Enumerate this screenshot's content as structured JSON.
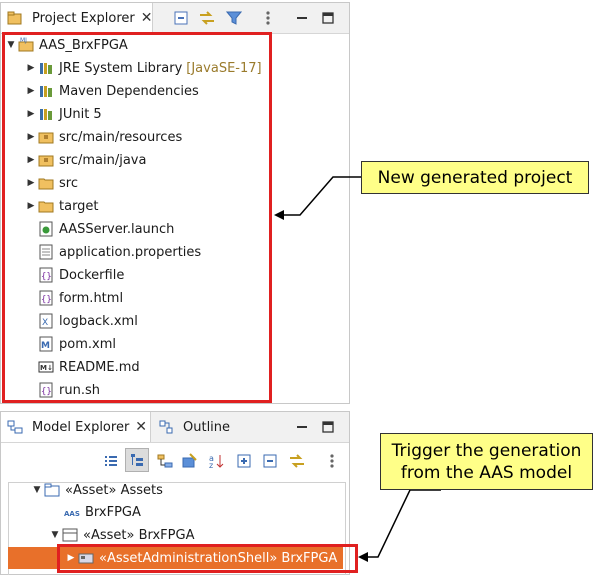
{
  "project_explorer": {
    "tab_label": "Project Explorer",
    "toolbar": [
      "collapse-all-icon",
      "link-with-editor-icon",
      "filter-icon",
      "view-menu-icon",
      "minimize-icon",
      "maximize-icon"
    ],
    "root": {
      "label": "AAS_BrxFPGA",
      "icon": "maven-project-icon"
    },
    "items": [
      {
        "label": "JRE System Library",
        "decoration": "[JavaSE-17]",
        "icon": "library-icon",
        "expandable": true
      },
      {
        "label": "Maven Dependencies",
        "icon": "library-icon",
        "expandable": true
      },
      {
        "label": "JUnit 5",
        "icon": "library-icon",
        "expandable": true
      },
      {
        "label": "src/main/resources",
        "icon": "package-folder-icon",
        "expandable": true
      },
      {
        "label": "src/main/java",
        "icon": "package-folder-icon",
        "expandable": true
      },
      {
        "label": "src",
        "icon": "folder-icon",
        "expandable": true
      },
      {
        "label": "target",
        "icon": "folder-icon",
        "expandable": true
      },
      {
        "label": "AASServer.launch",
        "icon": "launch-file-icon",
        "expandable": false
      },
      {
        "label": "application.properties",
        "icon": "text-file-icon",
        "expandable": false
      },
      {
        "label": "Dockerfile",
        "icon": "script-file-icon",
        "expandable": false
      },
      {
        "label": "form.html",
        "icon": "script-file-icon",
        "expandable": false
      },
      {
        "label": "logback.xml",
        "icon": "xml-file-icon",
        "expandable": false
      },
      {
        "label": "pom.xml",
        "icon": "maven-pom-icon",
        "expandable": false
      },
      {
        "label": "README.md",
        "icon": "markdown-file-icon",
        "expandable": false
      },
      {
        "label": "run.sh",
        "icon": "script-file-icon",
        "expandable": false
      }
    ]
  },
  "model_explorer": {
    "tab_label": "Model Explorer",
    "outline_tab_label": "Outline",
    "items": [
      {
        "label": "«Asset» Assets",
        "icon": "package-icon"
      },
      {
        "label": "BrxFPGA",
        "icon": "aas-icon"
      },
      {
        "label": "«Asset» BrxFPGA",
        "icon": "asset-icon"
      },
      {
        "label": "«AssetAdministrationShell» BrxFPGA",
        "icon": "shell-icon",
        "selected": true
      }
    ]
  },
  "callouts": {
    "new_project": "New generated project",
    "trigger_line1": "Trigger the generation",
    "trigger_line2": "from the AAS model"
  },
  "colors": {
    "highlight": "#e02020",
    "selection": "#e8702a",
    "callout": "#ffff88"
  }
}
